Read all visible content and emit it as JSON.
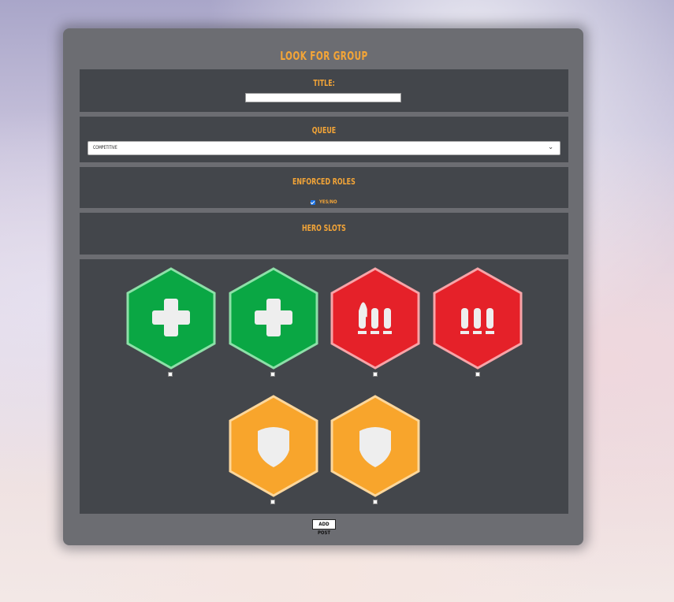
{
  "page": {
    "title": "Look For Group"
  },
  "form": {
    "title_label": "Title:",
    "title_value": "",
    "queue_label": "Queue",
    "queue_selected": "Competitive",
    "roles_label": "Enforced Roles",
    "roles_checkbox_label": "Yes/No",
    "roles_checked": true,
    "hero_slots_label": "Hero Slots",
    "submit_label": "Add Post"
  },
  "hero_slots": [
    {
      "role": "support",
      "icon": "cross-icon",
      "color": "#0aa744"
    },
    {
      "role": "support",
      "icon": "cross-icon",
      "color": "#0aa744"
    },
    {
      "role": "damage",
      "icon": "bullets-icon",
      "color": "#e52129"
    },
    {
      "role": "damage",
      "icon": "bullets-icon",
      "color": "#e52129"
    },
    {
      "role": "tank",
      "icon": "shield-icon",
      "color": "#f8a52c"
    },
    {
      "role": "tank",
      "icon": "shield-icon",
      "color": "#f8a52c"
    }
  ],
  "colors": {
    "accent": "#f4a537",
    "panel": "#6c6d72",
    "box": "#43464b"
  }
}
